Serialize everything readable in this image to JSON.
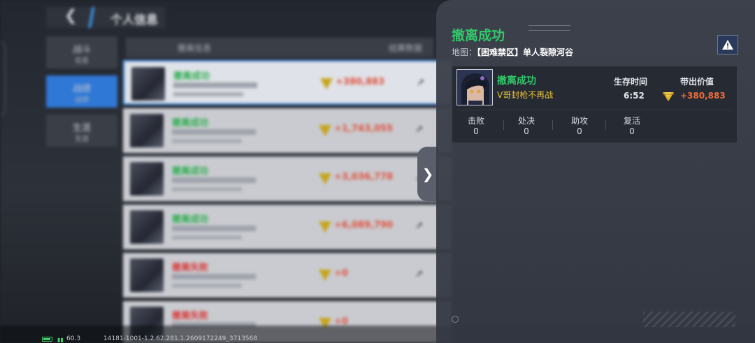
{
  "background": {
    "header_title": "个人信息",
    "side_tabs": [
      {
        "label": "战斗",
        "sub": "信息"
      },
      {
        "label": "战绩",
        "sub": "战绩"
      },
      {
        "label": "生涯",
        "sub": "生涯"
      }
    ],
    "table_headers": [
      "撤离信息",
      "结算数据"
    ],
    "rows": [
      {
        "status": "撤离成功",
        "status_type": "ok",
        "value": "+380,883"
      },
      {
        "status": "撤离成功",
        "status_type": "ok",
        "value": "+1,743,055"
      },
      {
        "status": "撤离成功",
        "status_type": "ok",
        "value": "+3,036,778"
      },
      {
        "status": "撤离成功",
        "status_type": "ok",
        "value": "+6,089,790"
      },
      {
        "status": "撤离失败",
        "status_type": "fail",
        "value": "+0"
      },
      {
        "status": "撤离失败",
        "status_type": "fail",
        "value": "+0"
      }
    ]
  },
  "panel": {
    "title": "撤离成功",
    "map_label": "地图：",
    "map_value": "【困难禁区】单人裂隙河谷",
    "card": {
      "status": "撤离成功",
      "player_name": "V哥封枪不再战",
      "survival_label": "生存时间",
      "survival_value": "6:52",
      "value_label": "带出价值",
      "value": "+380,883",
      "stats": [
        {
          "label": "击败",
          "value": "0"
        },
        {
          "label": "处决",
          "value": "0"
        },
        {
          "label": "助攻",
          "value": "0"
        },
        {
          "label": "复活",
          "value": "0"
        }
      ]
    }
  },
  "status_bar": {
    "fps": "60.3",
    "version": "14181-1001-1.2.62.281.1.2609172249_3713568"
  },
  "colors": {
    "success": "#31c86a",
    "failure": "#d93a3a",
    "value_orange": "#f06c37",
    "name_yellow": "#e6c23a",
    "accent_blue": "#2f78d6"
  }
}
